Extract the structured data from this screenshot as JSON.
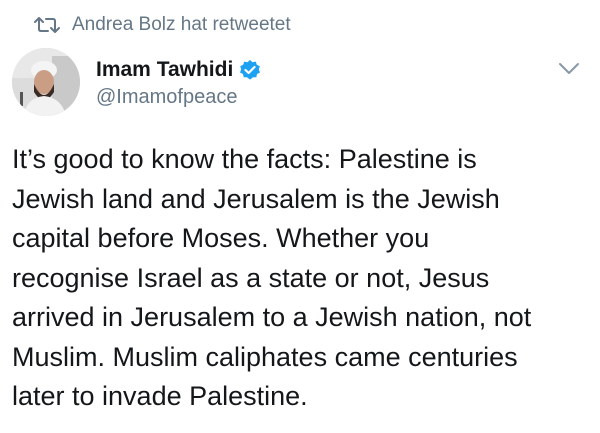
{
  "retweet": {
    "icon": "retweet-icon",
    "text": "Andrea Bolz hat retweetet"
  },
  "author": {
    "avatar": "avatar-photo",
    "display_name": "Imam Tawhidi",
    "verified_icon": "verified-badge-icon",
    "handle": "@Imamofpeace"
  },
  "menu": {
    "icon": "chevron-down-icon"
  },
  "tweet": {
    "lines": [
      "It’s good to know the facts: Palestine is",
      "Jewish land and Jerusalem is the Jewish",
      "capital before Moses. Whether you",
      "recognise Israel as a state or not, Jesus",
      "arrived in Jerusalem to a Jewish nation, not",
      "Muslim. Muslim caliphates came centuries",
      "later to invade Palestine."
    ]
  },
  "colors": {
    "text": "#14171a",
    "secondary": "#657786",
    "verified": "#1da1f2"
  }
}
